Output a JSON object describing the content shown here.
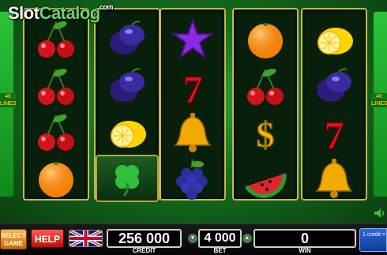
{
  "logo": {
    "part1": "Slot",
    "part2": "Catalog",
    "suffix": ".com"
  },
  "side_tags": {
    "left": "40 LINES",
    "right": "40 LINES"
  },
  "reels": [
    [
      "cherries",
      "cherries",
      "cherries",
      "orange"
    ],
    [
      "plum",
      "plum",
      "lemon",
      "clover"
    ],
    [
      "star",
      "seven",
      "bell",
      "grapes"
    ],
    [
      "orange",
      "cherries",
      "dollar",
      "watermelon"
    ],
    [
      "lemon",
      "plum",
      "seven",
      "bell"
    ]
  ],
  "controls": {
    "select_game": "SELECT GAME",
    "help": "HELP",
    "flag": "uk-flag-icon",
    "credit_value": "256 000",
    "credit_label": "CREDIT",
    "bet_value": "4 000",
    "bet_label": "BET",
    "win_value": "0",
    "win_label": "WIN",
    "denomination": "1 credit = 0,01 US"
  },
  "colors": {
    "table_green": "#15701f",
    "reel_frame": "#c9b94a",
    "help_red": "#d3231a",
    "select_orange": "#e8890f",
    "denom_blue": "#1b4fb8"
  }
}
